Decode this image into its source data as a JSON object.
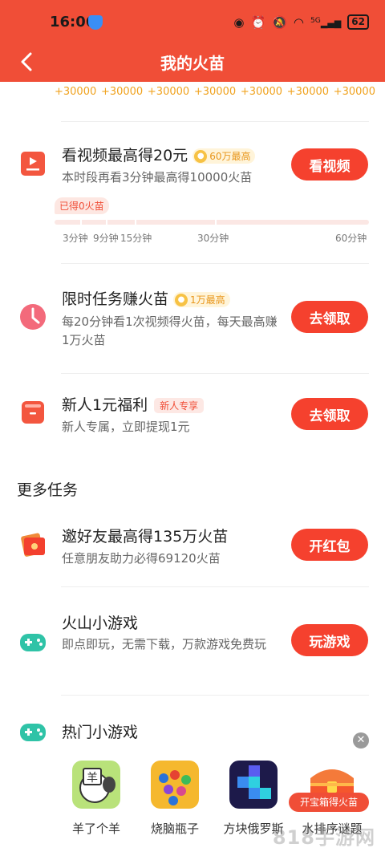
{
  "status_bar": {
    "time": "16:06",
    "battery": "62",
    "network": "5G"
  },
  "header": {
    "title": "我的火苗"
  },
  "reward_steps": [
    "+30000",
    "+30000",
    "+30000",
    "+30000",
    "+30000",
    "+30000",
    "+30000"
  ],
  "tasks": [
    {
      "title": "看视频最高得20元",
      "badge": "60万最高",
      "desc": "本时段再看3分钟最高得10000火苗",
      "button": "看视频",
      "earned_tag": "已得0火苗",
      "progress_fraction": 0,
      "progress_ticks": [
        "3分钟",
        "9分钟",
        "15分钟",
        "30分钟",
        "60分钟"
      ]
    },
    {
      "title": "限时任务赚火苗",
      "badge": "1万最高",
      "desc": "每20分钟看1次视频得火苗，每天最高赚1万火苗",
      "button": "去领取"
    },
    {
      "title": "新人1元福利",
      "badge": "新人专享",
      "desc": "新人专属，立即提现1元",
      "button": "去领取"
    }
  ],
  "more_section": {
    "title": "更多任务"
  },
  "more_tasks": [
    {
      "title": "邀好友最高得135万火苗",
      "desc": "任意朋友助力必得69120火苗",
      "button": "开红包"
    },
    {
      "title": "火山小游戏",
      "desc": "即点即玩，无需下载，万款游戏免费玩",
      "button": "玩游戏"
    },
    {
      "title": "热门小游戏"
    }
  ],
  "games": [
    {
      "name": "羊了个羊",
      "icon_text": "羊"
    },
    {
      "name": "烧脑瓶子"
    },
    {
      "name": "方块俄罗斯"
    },
    {
      "name": "水排序谜题",
      "overlay_label": "开宝箱得火苗"
    }
  ],
  "watermark": "818手游网",
  "colors": {
    "primary": "#f04e37",
    "accent_gold": "#f0a21e",
    "teal_icon": "#2fc3a7"
  }
}
